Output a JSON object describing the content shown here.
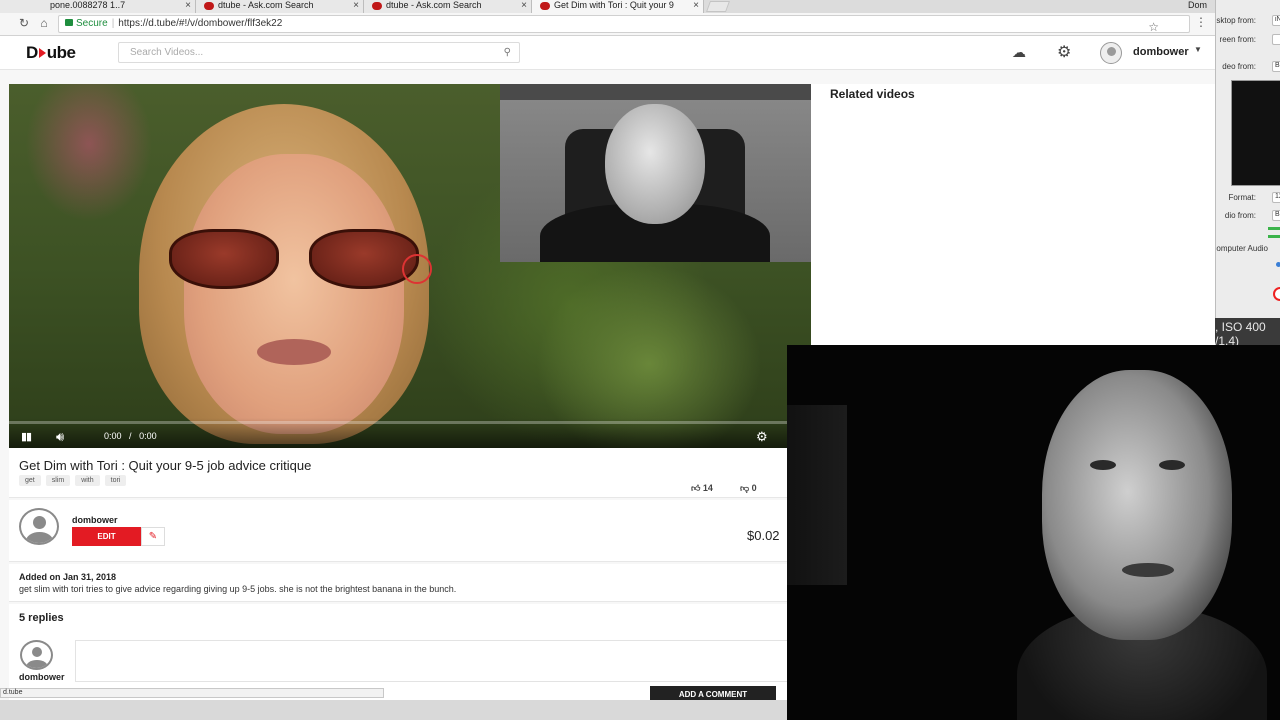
{
  "browser": {
    "tabs": [
      {
        "label": "pone.0088278 1..7"
      },
      {
        "label": "dtube - Ask.com Search"
      },
      {
        "label": "dtube - Ask.com Search"
      },
      {
        "label": "Get Dim with Tori : Quit your 9"
      }
    ],
    "profile_name": "Dom",
    "secure_label": "Secure",
    "url": "https://d.tube/#!/v/dombower/flf3ek22",
    "status_url": "d.tube"
  },
  "site": {
    "logo_left": "D",
    "logo_right": "ube",
    "search_placeholder": "Search Videos...",
    "username": "dombower",
    "accent": "#e31b23"
  },
  "player": {
    "time_current": "0:00",
    "time_sep": "/",
    "time_total": "0:00",
    "progress": 0
  },
  "related": {
    "title": "Related videos"
  },
  "video": {
    "title": "Get Dim with Tori : Quit your 9-5 job advice critique",
    "tags": [
      "get",
      "slim",
      "with",
      "tori"
    ],
    "likes": "14",
    "dislikes": "0",
    "author": "dombower",
    "edit_label": "EDIT",
    "payout": "$0.02",
    "added": "Added on Jan 31, 2018",
    "description": "get slim with tori tries to give advice regarding giving up 9-5 jobs. she is not the brightest banana in the bunch."
  },
  "comments": {
    "count_label": "5 replies",
    "user": "dombower",
    "add_label": "ADD A COMMENT"
  },
  "recorder": {
    "labels": [
      "sktop from:",
      "reen from:",
      "deo from:",
      "Format:",
      "dio from:",
      "omputer Audio"
    ],
    "fields": [
      "iN",
      "",
      "B",
      "12",
      "B",
      ""
    ],
    "exif_line1": ", ISO 400",
    "exif_line2": "/1.4)"
  }
}
